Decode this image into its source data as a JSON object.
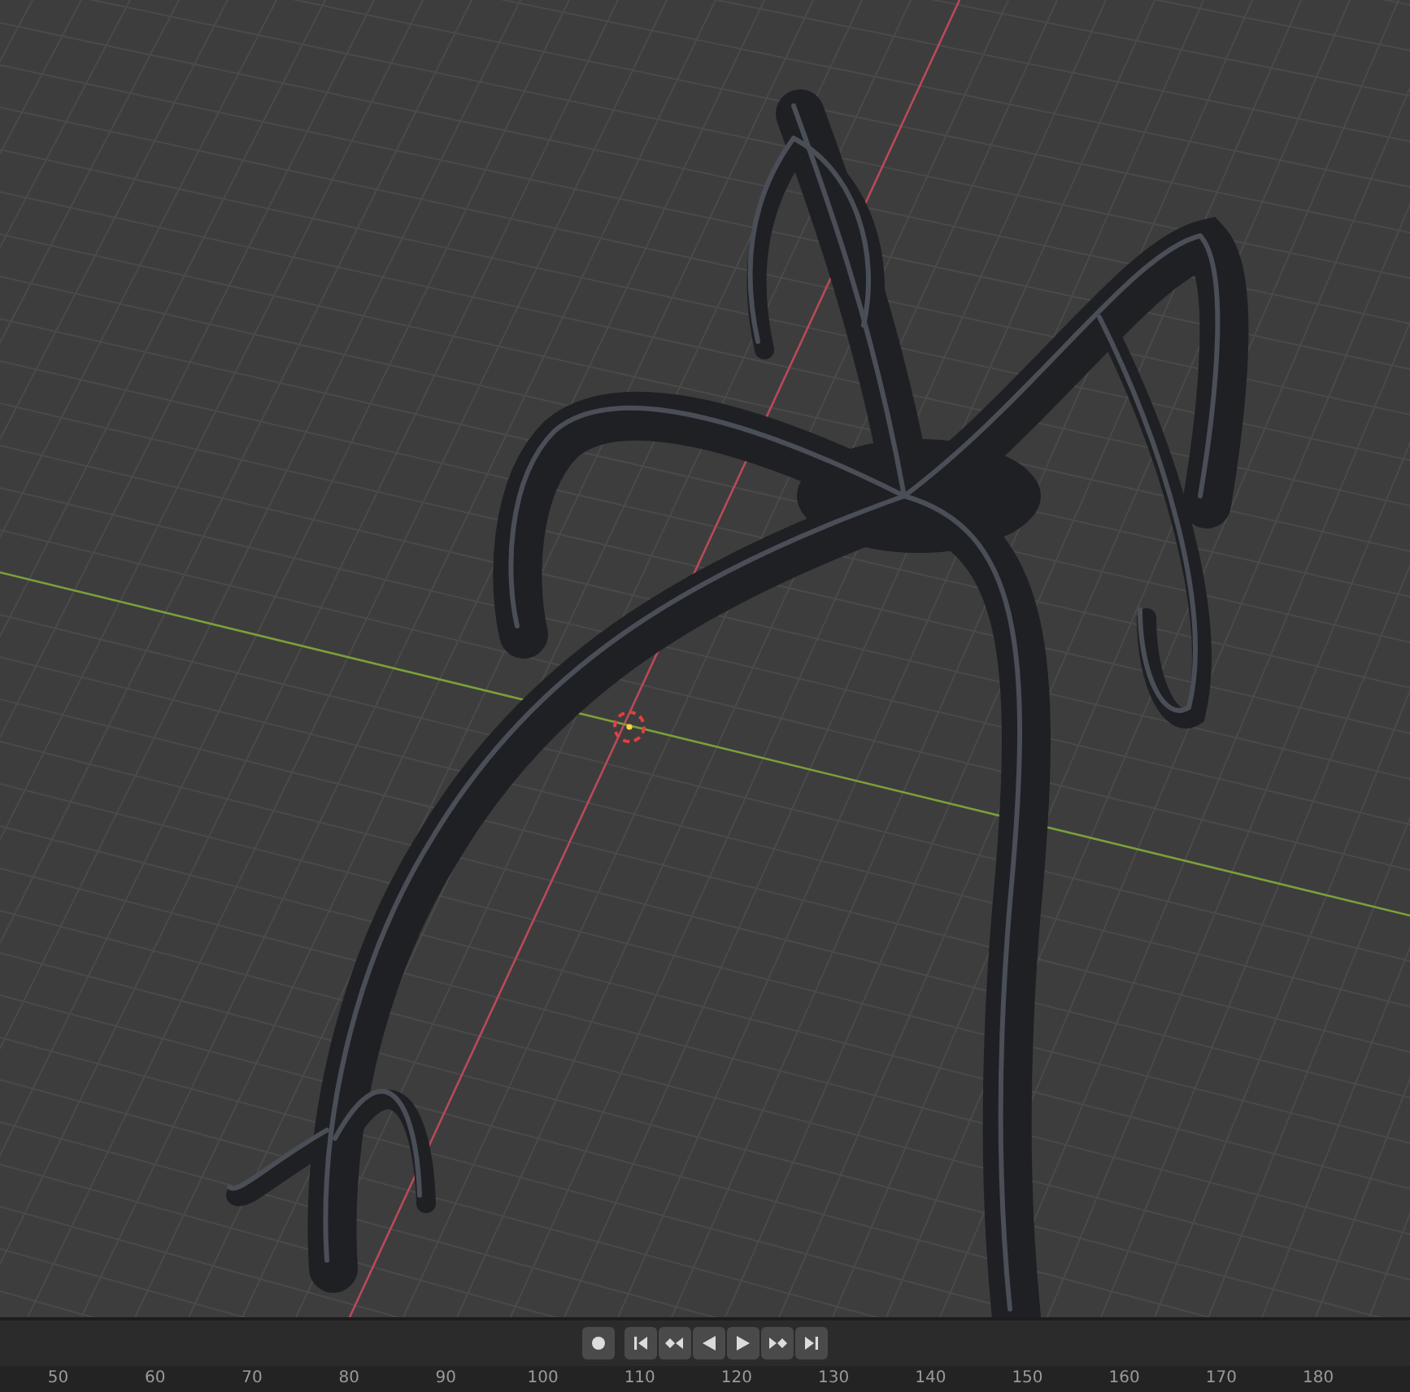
{
  "timeline": {
    "record_button": {
      "active": false
    },
    "playback_controls": [
      {
        "kind": "jump_start"
      },
      {
        "kind": "prev_keyframe"
      },
      {
        "kind": "play_reverse"
      },
      {
        "kind": "play"
      },
      {
        "kind": "next_keyframe"
      },
      {
        "kind": "jump_end"
      }
    ],
    "frame_ticks": [
      "50",
      "60",
      "70",
      "80",
      "90",
      "100",
      "110",
      "120",
      "130",
      "140",
      "150",
      "160",
      "170",
      "180"
    ]
  }
}
